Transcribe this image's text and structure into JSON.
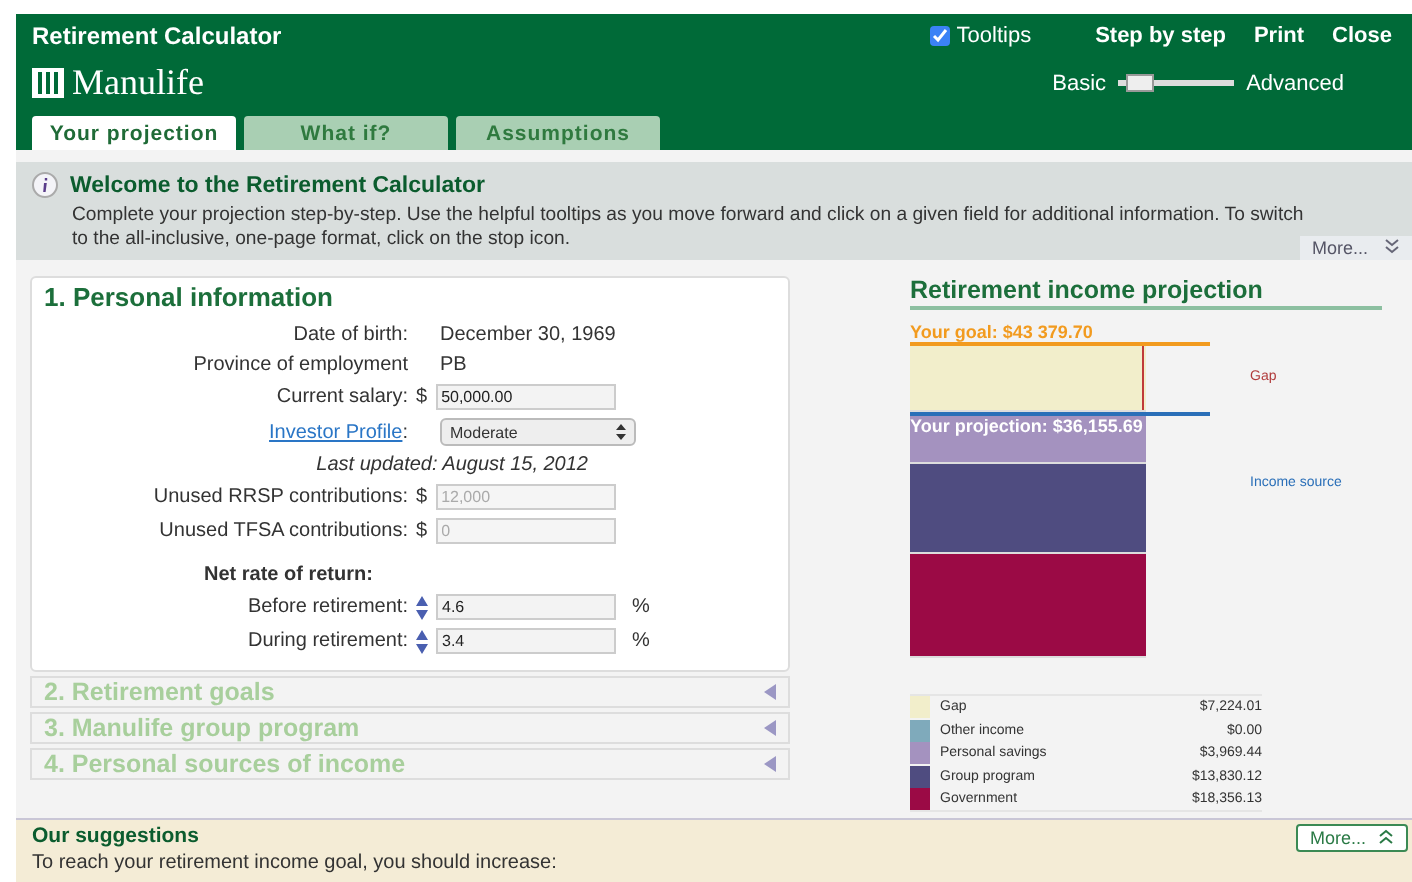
{
  "window": {
    "title": "Retirement Calculator"
  },
  "header": {
    "tooltips": {
      "label": "Tooltips",
      "checked": true
    },
    "links": [
      "Step by step",
      "Print",
      "Close"
    ],
    "logo": "Manulife",
    "mode": {
      "left": "Basic",
      "right": "Advanced",
      "level": 0.1
    }
  },
  "tabs": [
    {
      "label": "Your projection",
      "selected": true
    },
    {
      "label": "What if?",
      "selected": false
    },
    {
      "label": "Assumptions",
      "selected": false
    }
  ],
  "welcome": {
    "title": "Welcome to the Retirement Calculator",
    "text": "Complete your projection step-by-step. Use the helpful tooltips as you move forward and click on a given field for additional information. To switch to the all-inclusive, one-page format, click on the stop icon.",
    "more": "More..."
  },
  "sections": [
    {
      "title": "1. Personal information",
      "expanded": true
    },
    {
      "title": "2. Retirement goals",
      "expanded": false
    },
    {
      "title": "3. Manulife group program",
      "expanded": false
    },
    {
      "title": "4. Personal sources of income",
      "expanded": false
    }
  ],
  "personal": {
    "rows": [
      {
        "kind": "text",
        "label": "Date of birth:",
        "value": "December 30, 1969"
      },
      {
        "kind": "text",
        "label": "Province of employment",
        "value": "PB"
      },
      {
        "kind": "input",
        "label": "Current salary:",
        "prefix": "$",
        "value": "50,000.00",
        "disabled": false
      },
      {
        "kind": "select",
        "link": "Investor Profile",
        "colon": ":",
        "value": "Moderate"
      },
      {
        "kind": "note",
        "value": "Last updated: August 15, 2012"
      },
      {
        "kind": "input",
        "label": "Unused RRSP contributions:",
        "prefix": "$",
        "value": "12,000",
        "disabled": true
      },
      {
        "kind": "input",
        "label": "Unused TFSA contributions:",
        "prefix": "$",
        "value": "0",
        "disabled": true
      }
    ],
    "net_rate": {
      "title": "Net rate of return:",
      "rows": [
        {
          "label": "Before retirement:",
          "value": "4.6",
          "unit": "%"
        },
        {
          "label": "During retirement:",
          "value": "3.4",
          "unit": "%"
        }
      ]
    }
  },
  "projection": {
    "title": "Retirement income projection",
    "goal": "Your goal: $43 379.70",
    "projection": "Your projection: $36,155.69",
    "gap_label": "Gap",
    "source_label": "Income source",
    "legend": [
      {
        "name": "Gap",
        "amount": "$7,224.01",
        "color": "#f2eecb"
      },
      {
        "name": "Other income",
        "amount": "$0.00",
        "color": "#7faabb"
      },
      {
        "name": "Personal savings",
        "amount": "$3,969.44",
        "color": "#a492bf"
      },
      {
        "name": "Group program",
        "amount": "$13,830.12",
        "color": "#4f4c80"
      },
      {
        "name": "Government",
        "amount": "$18,356.13",
        "color": "#9b0a45"
      }
    ]
  },
  "suggestions": {
    "title": "Our suggestions",
    "text": "To reach your retirement income goal, you should increase:",
    "more": "More..."
  }
}
